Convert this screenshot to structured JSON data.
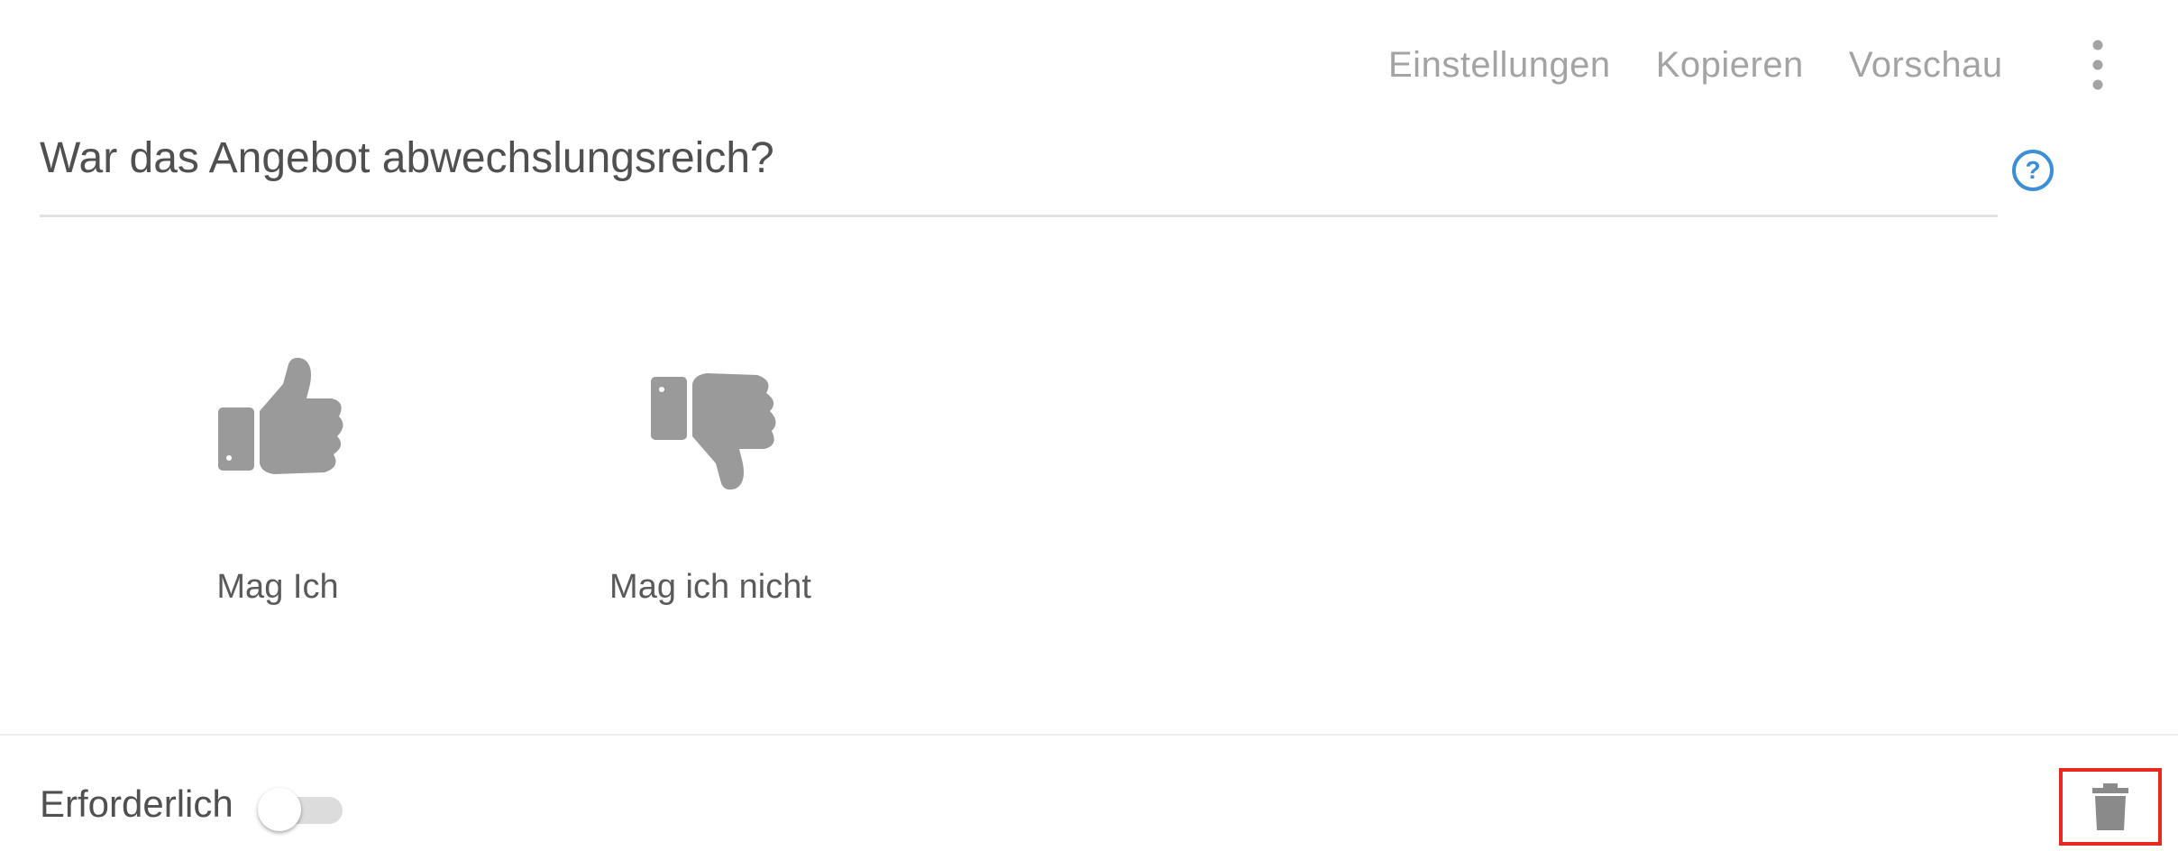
{
  "toolbar": {
    "settings_label": "Einstellungen",
    "copy_label": "Kopieren",
    "preview_label": "Vorschau",
    "more_icon": "more-vertical-icon"
  },
  "question": {
    "text": "War das Angebot abwechslungsreich?",
    "help_icon": "help-circle-icon"
  },
  "options": [
    {
      "label": "Mag Ich",
      "icon": "thumbs-up-icon"
    },
    {
      "label": "Mag ich nicht",
      "icon": "thumbs-down-icon"
    }
  ],
  "footer": {
    "required_label": "Erforderlich",
    "required_enabled": false,
    "delete_icon": "trash-icon"
  },
  "colors": {
    "text": "#505050",
    "muted": "#a3a3a3",
    "icon": "#9a9a9a",
    "help_accent": "#3b8fd6",
    "highlight": "#e8271d"
  }
}
